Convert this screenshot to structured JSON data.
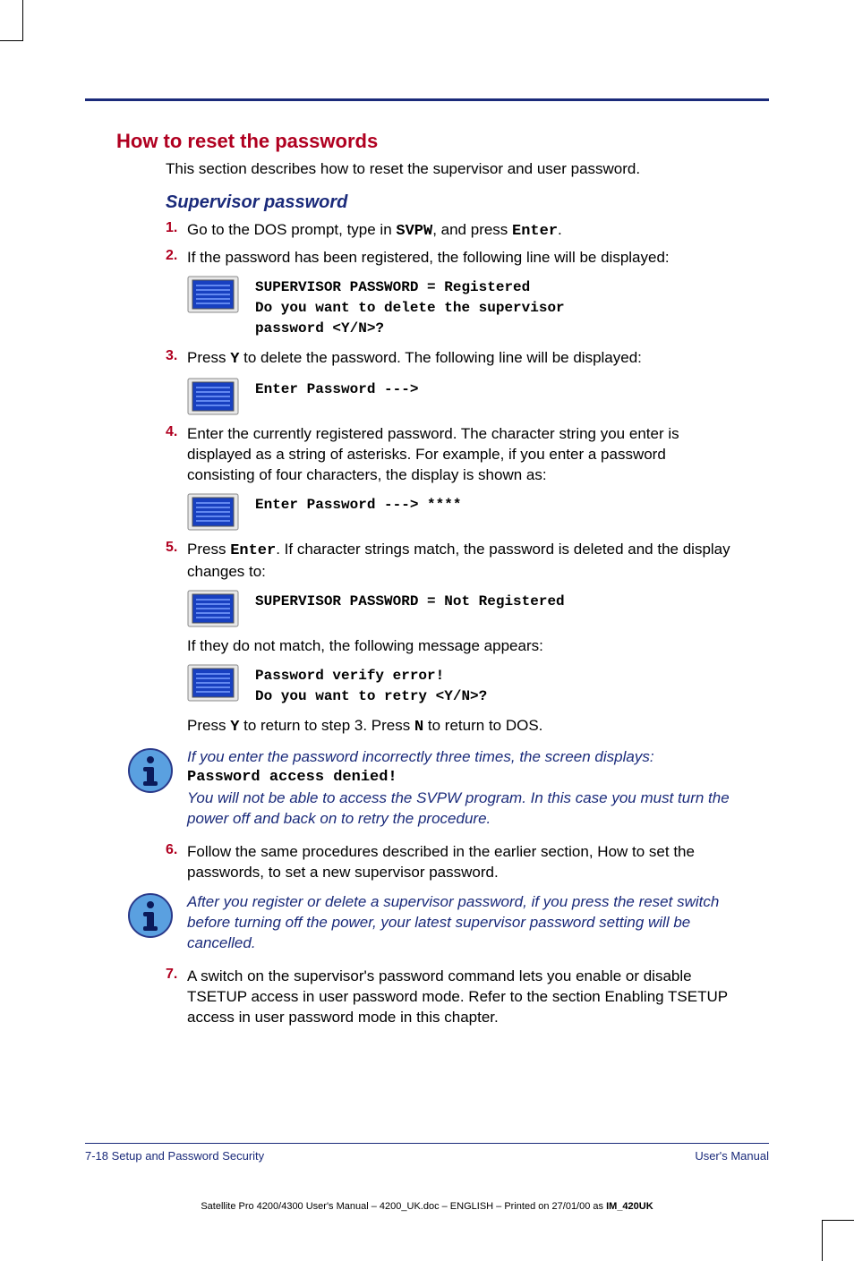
{
  "heading": "How to reset the passwords",
  "intro": "This section describes how to reset the supervisor and user password.",
  "subheading": "Supervisor password",
  "steps": {
    "s1": {
      "num": "1.",
      "pre": "Go to the DOS prompt, type in ",
      "cmd": "SVPW",
      "mid": ", and press ",
      "key": "Enter",
      "post": "."
    },
    "s2": {
      "num": "2.",
      "text": "If the password has been registered, the following line will be displayed:"
    },
    "screen1": "SUPERVISOR PASSWORD = Registered\nDo you want to delete the supervisor\npassword <Y/N>?",
    "s3": {
      "num": "3.",
      "pre": "Press ",
      "key": "Y",
      "post": " to delete the password. The following line will be displayed:"
    },
    "screen2": "Enter Password --->",
    "s4": {
      "num": "4.",
      "text": "Enter the currently registered password. The character string you enter is displayed as a string of asterisks. For example, if you enter a password consisting of four characters, the display is shown as:"
    },
    "screen3": "Enter Password ---> ****",
    "s5": {
      "num": "5.",
      "pre": "Press ",
      "key": "Enter",
      "post": ". If character strings match, the password is deleted and the display changes to:"
    },
    "screen4": "SUPERVISOR PASSWORD = Not Registered",
    "nomatch": "If they do not match, the following message appears:",
    "screen5": "Password verify error!\nDo you want to retry <Y/N>?",
    "s5b": {
      "pre": "Press ",
      "k1": "Y",
      "mid": " to return to step 3. Press ",
      "k2": "N",
      "post": " to return to DOS."
    },
    "info1_line1": "If you enter the password incorrectly three times, the screen displays:",
    "info1_code": "Password access denied!",
    "info1_line2": "You will not be able to access the SVPW program. In this case you must turn the power off and back on to retry the procedure.",
    "s6": {
      "num": "6.",
      "text": "Follow the same procedures described in the earlier section, How to set the passwords, to set a new supervisor password."
    },
    "info2": "After you register or delete a supervisor password, if you press the reset switch before turning off the power, your latest supervisor password setting will be cancelled.",
    "s7": {
      "num": "7.",
      "text": "A switch on the supervisor's password command lets you enable or disable TSETUP access in user password mode. Refer to the section Enabling TSETUP access in user password mode in this chapter."
    }
  },
  "footer": {
    "left": "7-18  Setup and Password Security",
    "right": "User's Manual"
  },
  "printline": {
    "pre": "Satellite Pro 4200/4300 User's Manual  – 4200_UK.doc – ENGLISH – Printed on 27/01/00 as ",
    "bold": "IM_420UK"
  }
}
